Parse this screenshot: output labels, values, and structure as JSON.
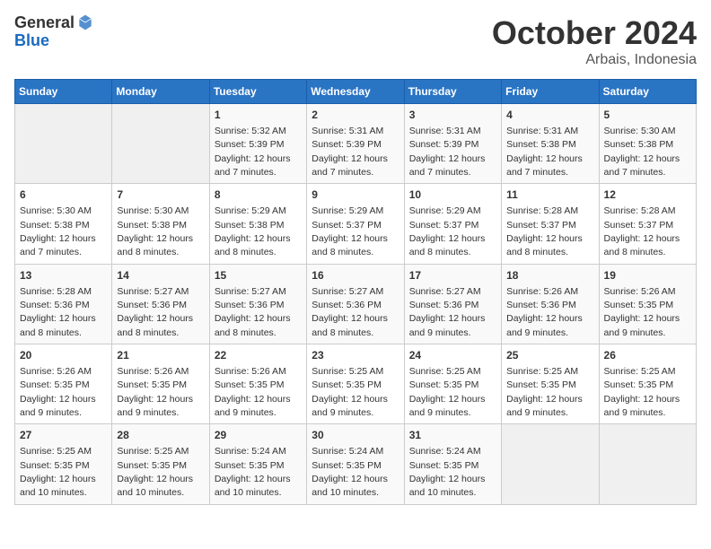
{
  "logo": {
    "general": "General",
    "blue": "Blue"
  },
  "header": {
    "month": "October 2024",
    "location": "Arbais, Indonesia"
  },
  "days_of_week": [
    "Sunday",
    "Monday",
    "Tuesday",
    "Wednesday",
    "Thursday",
    "Friday",
    "Saturday"
  ],
  "weeks": [
    [
      null,
      null,
      {
        "day": "1",
        "sunrise": "5:32 AM",
        "sunset": "5:39 PM",
        "daylight": "12 hours and 7 minutes."
      },
      {
        "day": "2",
        "sunrise": "5:31 AM",
        "sunset": "5:39 PM",
        "daylight": "12 hours and 7 minutes."
      },
      {
        "day": "3",
        "sunrise": "5:31 AM",
        "sunset": "5:39 PM",
        "daylight": "12 hours and 7 minutes."
      },
      {
        "day": "4",
        "sunrise": "5:31 AM",
        "sunset": "5:38 PM",
        "daylight": "12 hours and 7 minutes."
      },
      {
        "day": "5",
        "sunrise": "5:30 AM",
        "sunset": "5:38 PM",
        "daylight": "12 hours and 7 minutes."
      }
    ],
    [
      {
        "day": "6",
        "sunrise": "5:30 AM",
        "sunset": "5:38 PM",
        "daylight": "12 hours and 7 minutes."
      },
      {
        "day": "7",
        "sunrise": "5:30 AM",
        "sunset": "5:38 PM",
        "daylight": "12 hours and 8 minutes."
      },
      {
        "day": "8",
        "sunrise": "5:29 AM",
        "sunset": "5:38 PM",
        "daylight": "12 hours and 8 minutes."
      },
      {
        "day": "9",
        "sunrise": "5:29 AM",
        "sunset": "5:37 PM",
        "daylight": "12 hours and 8 minutes."
      },
      {
        "day": "10",
        "sunrise": "5:29 AM",
        "sunset": "5:37 PM",
        "daylight": "12 hours and 8 minutes."
      },
      {
        "day": "11",
        "sunrise": "5:28 AM",
        "sunset": "5:37 PM",
        "daylight": "12 hours and 8 minutes."
      },
      {
        "day": "12",
        "sunrise": "5:28 AM",
        "sunset": "5:37 PM",
        "daylight": "12 hours and 8 minutes."
      }
    ],
    [
      {
        "day": "13",
        "sunrise": "5:28 AM",
        "sunset": "5:36 PM",
        "daylight": "12 hours and 8 minutes."
      },
      {
        "day": "14",
        "sunrise": "5:27 AM",
        "sunset": "5:36 PM",
        "daylight": "12 hours and 8 minutes."
      },
      {
        "day": "15",
        "sunrise": "5:27 AM",
        "sunset": "5:36 PM",
        "daylight": "12 hours and 8 minutes."
      },
      {
        "day": "16",
        "sunrise": "5:27 AM",
        "sunset": "5:36 PM",
        "daylight": "12 hours and 8 minutes."
      },
      {
        "day": "17",
        "sunrise": "5:27 AM",
        "sunset": "5:36 PM",
        "daylight": "12 hours and 9 minutes."
      },
      {
        "day": "18",
        "sunrise": "5:26 AM",
        "sunset": "5:36 PM",
        "daylight": "12 hours and 9 minutes."
      },
      {
        "day": "19",
        "sunrise": "5:26 AM",
        "sunset": "5:35 PM",
        "daylight": "12 hours and 9 minutes."
      }
    ],
    [
      {
        "day": "20",
        "sunrise": "5:26 AM",
        "sunset": "5:35 PM",
        "daylight": "12 hours and 9 minutes."
      },
      {
        "day": "21",
        "sunrise": "5:26 AM",
        "sunset": "5:35 PM",
        "daylight": "12 hours and 9 minutes."
      },
      {
        "day": "22",
        "sunrise": "5:26 AM",
        "sunset": "5:35 PM",
        "daylight": "12 hours and 9 minutes."
      },
      {
        "day": "23",
        "sunrise": "5:25 AM",
        "sunset": "5:35 PM",
        "daylight": "12 hours and 9 minutes."
      },
      {
        "day": "24",
        "sunrise": "5:25 AM",
        "sunset": "5:35 PM",
        "daylight": "12 hours and 9 minutes."
      },
      {
        "day": "25",
        "sunrise": "5:25 AM",
        "sunset": "5:35 PM",
        "daylight": "12 hours and 9 minutes."
      },
      {
        "day": "26",
        "sunrise": "5:25 AM",
        "sunset": "5:35 PM",
        "daylight": "12 hours and 9 minutes."
      }
    ],
    [
      {
        "day": "27",
        "sunrise": "5:25 AM",
        "sunset": "5:35 PM",
        "daylight": "12 hours and 10 minutes."
      },
      {
        "day": "28",
        "sunrise": "5:25 AM",
        "sunset": "5:35 PM",
        "daylight": "12 hours and 10 minutes."
      },
      {
        "day": "29",
        "sunrise": "5:24 AM",
        "sunset": "5:35 PM",
        "daylight": "12 hours and 10 minutes."
      },
      {
        "day": "30",
        "sunrise": "5:24 AM",
        "sunset": "5:35 PM",
        "daylight": "12 hours and 10 minutes."
      },
      {
        "day": "31",
        "sunrise": "5:24 AM",
        "sunset": "5:35 PM",
        "daylight": "12 hours and 10 minutes."
      },
      null,
      null
    ]
  ]
}
